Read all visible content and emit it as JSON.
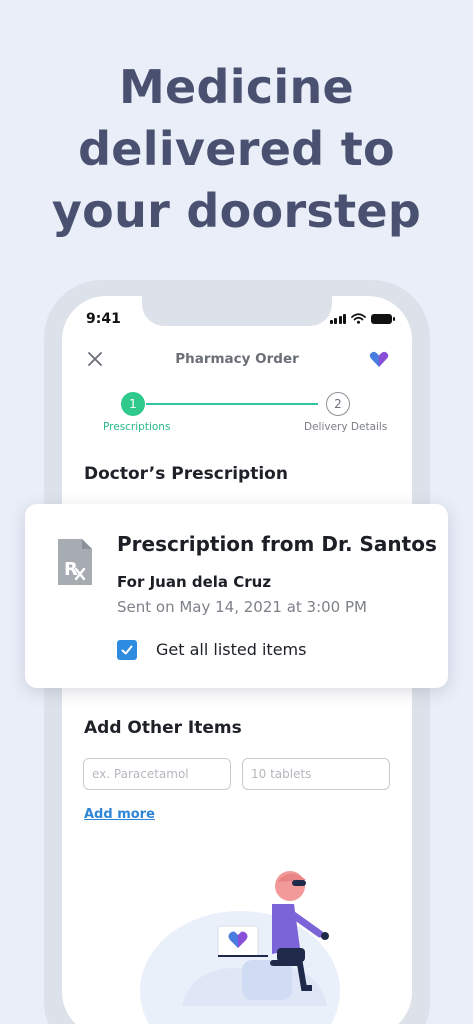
{
  "hero": {
    "line1": "Medicine",
    "line2": "delivered to",
    "line3": "your doorstep"
  },
  "status_bar": {
    "time": "9:41"
  },
  "nav": {
    "title": "Pharmacy Order"
  },
  "stepper": {
    "steps": [
      {
        "number": "1",
        "label": "Prescriptions",
        "state": "active"
      },
      {
        "number": "2",
        "label": "Delivery Details",
        "state": "inactive"
      }
    ]
  },
  "prescription_section": {
    "title": "Doctor’s Prescription"
  },
  "prescription_card": {
    "title": "Prescription from Dr. Santos",
    "patient": "For Juan dela Cruz",
    "sent": "Sent on May 14, 2021 at 3:00 PM",
    "checkbox_label": "Get all listed items",
    "checked": true
  },
  "other_items": {
    "title": "Add Other Items",
    "name_placeholder": "ex. Paracetamol",
    "qty_placeholder": "10 tablets",
    "add_more": "Add more"
  },
  "colors": {
    "background": "#e9eef8",
    "headline": "#4a5170",
    "accent_green": "#2fc98b",
    "accent_blue": "#2d8be0",
    "logo_purple": "#7a5ce0"
  }
}
